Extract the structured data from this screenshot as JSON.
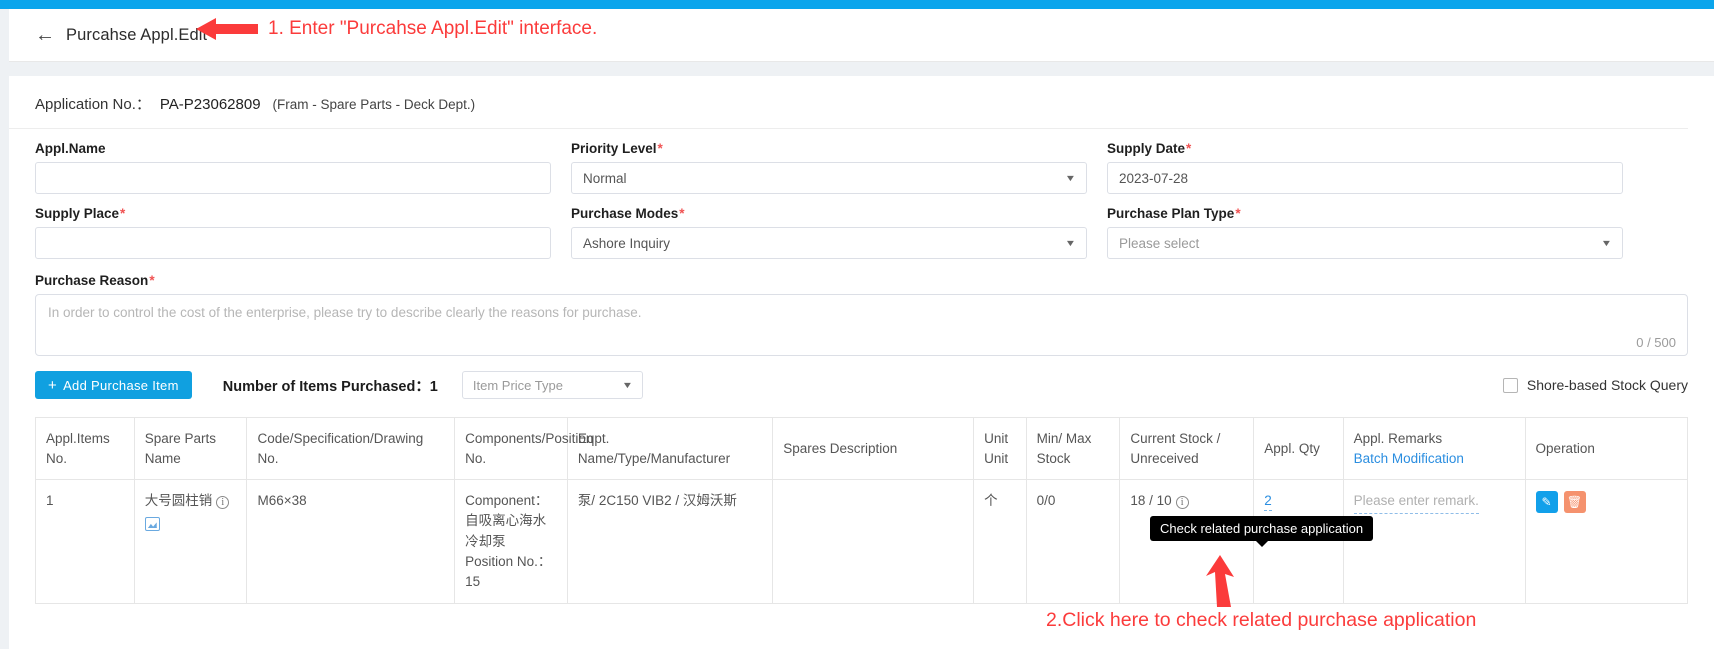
{
  "header": {
    "back_icon": "arrow-left-icon",
    "title": "Purcahse Appl.Edit"
  },
  "annotations": {
    "step1": "1. Enter \"Purcahse Appl.Edit\" interface.",
    "step2": "2.Click here to check related purchase application",
    "color": "#fb3b3b"
  },
  "tooltip": {
    "text": "Check related purchase application"
  },
  "application": {
    "label": "Application No.：",
    "number": "PA-P23062809",
    "department": "(Fram - Spare Parts - Deck Dept.)"
  },
  "form": {
    "appl_name": {
      "label": "Appl.Name",
      "required": false,
      "value": "",
      "placeholder": ""
    },
    "priority_level": {
      "label": "Priority Level",
      "required": true,
      "value": "Normal"
    },
    "supply_date": {
      "label": "Supply Date",
      "required": true,
      "value": "2023-07-28"
    },
    "supply_place": {
      "label": "Supply Place",
      "required": true,
      "value": "",
      "placeholder": ""
    },
    "purchase_modes": {
      "label": "Purchase Modes",
      "required": true,
      "value": "Ashore Inquiry"
    },
    "purchase_plan_type": {
      "label": "Purchase Plan Type",
      "required": true,
      "value": "Please select"
    },
    "purchase_reason": {
      "label": "Purchase Reason",
      "required": true,
      "value": "",
      "placeholder": "In order to control the cost of the enterprise, please try to describe clearly the reasons for purchase.",
      "counter": "0 / 500"
    },
    "required_marker": "*"
  },
  "toolbar": {
    "add_item_label": "Add  Purchase  Item",
    "add_item_plus": "+",
    "items_purchased": "Number of Items Purchased：1",
    "price_type": "Item Price Type",
    "shore_query": "Shore-based Stock Query",
    "shore_query_checked": false
  },
  "table": {
    "headers": [
      "Appl.Items No.",
      "Spare Parts Name",
      "Code/Specification/Drawing No.",
      "Components/Position No.",
      "Eqpt. Name/Type/Manufacturer",
      "Spares Description",
      "Unit Unit",
      "Min/ Max Stock",
      "Current Stock / Unreceived",
      "Appl. Qty",
      "Appl. Remarks",
      "Operation"
    ],
    "batch_modification": "Batch Modification",
    "rows": [
      {
        "item_no": "1",
        "spare_parts_name": "大号圆柱销",
        "code_spec": "M66×38",
        "component_label": "Component：",
        "component_value": "自吸离心海水冷却泵",
        "position_label": "Position No.：",
        "position_value": "15",
        "eqpt": "泵/ 2C150 VIB2 / 汉姆沃斯",
        "spares_description": "",
        "unit": "个",
        "min_max_stock": "0/0",
        "current_stock": "18 / 10",
        "appl_qty": "2",
        "remark_placeholder": "Please enter remark.",
        "operations": [
          "edit-icon",
          "delete-icon"
        ]
      }
    ]
  },
  "colors": {
    "accent": "#10a0e0",
    "top_strip": "#0ba5ec",
    "required": "#f05252",
    "link": "#2b8ee0",
    "delete": "#f5926e"
  }
}
